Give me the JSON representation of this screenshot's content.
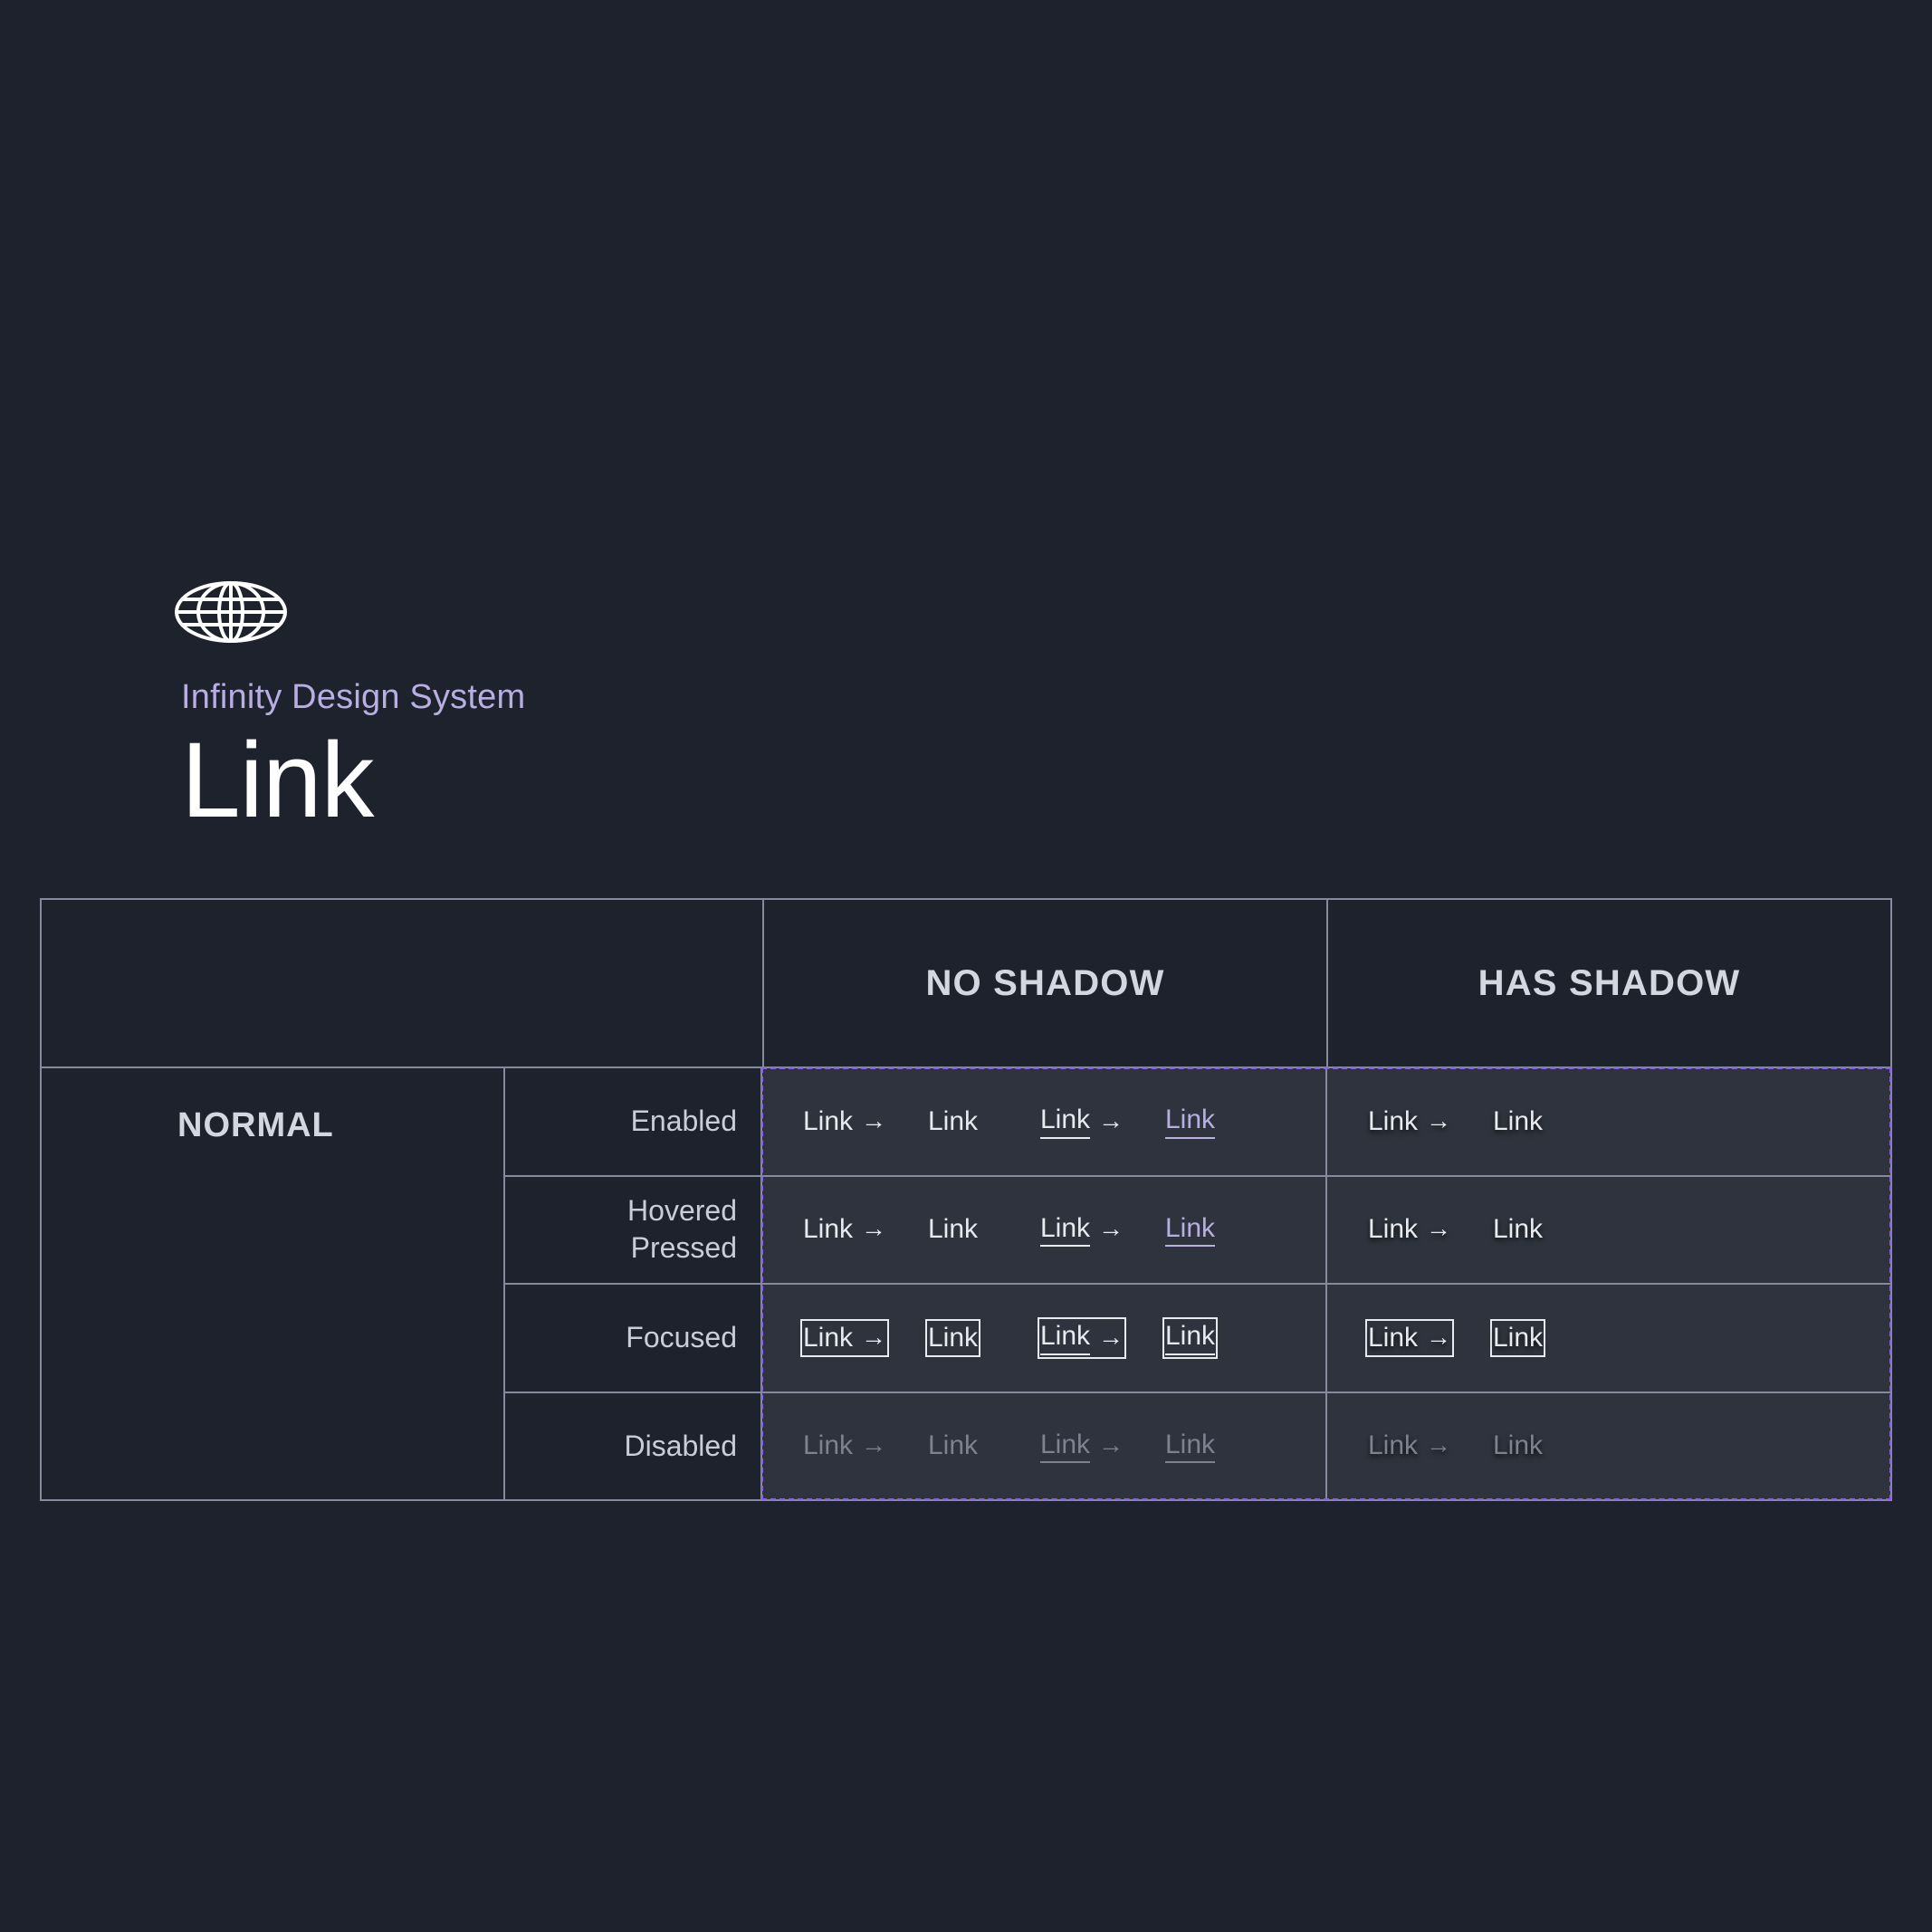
{
  "brand": {
    "logo_icon": "globe-wireframe-icon",
    "eyebrow": "Infinity Design System",
    "title": "Link"
  },
  "table": {
    "column_headers": [
      "NO SHADOW",
      "HAS SHADOW"
    ],
    "group_label": "NORMAL",
    "state_labels": [
      "Enabled",
      "Hovered\nPressed",
      "Focused",
      "Disabled"
    ],
    "link_label": "Link",
    "arrow_glyph": "→",
    "colors": {
      "page_background": "#1e222c",
      "cell_background": "#2f333d",
      "border": "#848b9c",
      "accent_purple": "#b9aee2",
      "selection_outline": "#8b5cf6",
      "text_primary": "#e8eaf0",
      "text_disabled": "#7c8290"
    },
    "rows": [
      {
        "state": "Enabled",
        "no_shadow": [
          {
            "label": "Link",
            "arrow": true,
            "underline": false,
            "color": "default"
          },
          {
            "label": "Link",
            "arrow": false,
            "underline": false,
            "color": "default"
          },
          {
            "label": "Link",
            "arrow": true,
            "underline": true,
            "color": "default"
          },
          {
            "label": "Link",
            "arrow": false,
            "underline": true,
            "color": "accent"
          }
        ],
        "has_shadow": [
          {
            "label": "Link",
            "arrow": true,
            "underline": false,
            "color": "default"
          },
          {
            "label": "Link",
            "arrow": false,
            "underline": false,
            "color": "default"
          }
        ]
      },
      {
        "state": "Hovered Pressed",
        "no_shadow": [
          {
            "label": "Link",
            "arrow": true,
            "underline": false,
            "color": "default"
          },
          {
            "label": "Link",
            "arrow": false,
            "underline": false,
            "color": "default"
          },
          {
            "label": "Link",
            "arrow": true,
            "underline": true,
            "color": "default"
          },
          {
            "label": "Link",
            "arrow": false,
            "underline": true,
            "color": "accent"
          }
        ],
        "has_shadow": [
          {
            "label": "Link",
            "arrow": true,
            "underline": false,
            "color": "default"
          },
          {
            "label": "Link",
            "arrow": false,
            "underline": false,
            "color": "default"
          }
        ]
      },
      {
        "state": "Focused",
        "no_shadow": [
          {
            "label": "Link",
            "arrow": true,
            "underline": false,
            "color": "default",
            "focus_ring": true
          },
          {
            "label": "Link",
            "arrow": false,
            "underline": false,
            "color": "default",
            "focus_ring": true
          },
          {
            "label": "Link",
            "arrow": true,
            "underline": true,
            "color": "default",
            "focus_ring": true
          },
          {
            "label": "Link",
            "arrow": false,
            "underline": true,
            "color": "default",
            "focus_ring": true
          }
        ],
        "has_shadow": [
          {
            "label": "Link",
            "arrow": true,
            "underline": false,
            "color": "default",
            "focus_ring": true
          },
          {
            "label": "Link",
            "arrow": false,
            "underline": false,
            "color": "default",
            "focus_ring": true
          }
        ]
      },
      {
        "state": "Disabled",
        "no_shadow": [
          {
            "label": "Link",
            "arrow": true,
            "underline": false,
            "color": "disabled"
          },
          {
            "label": "Link",
            "arrow": false,
            "underline": false,
            "color": "disabled"
          },
          {
            "label": "Link",
            "arrow": true,
            "underline": true,
            "color": "disabled"
          },
          {
            "label": "Link",
            "arrow": false,
            "underline": true,
            "color": "disabled"
          }
        ],
        "has_shadow": [
          {
            "label": "Link",
            "arrow": true,
            "underline": false,
            "color": "disabled"
          },
          {
            "label": "Link",
            "arrow": false,
            "underline": false,
            "color": "disabled"
          }
        ]
      }
    ]
  }
}
